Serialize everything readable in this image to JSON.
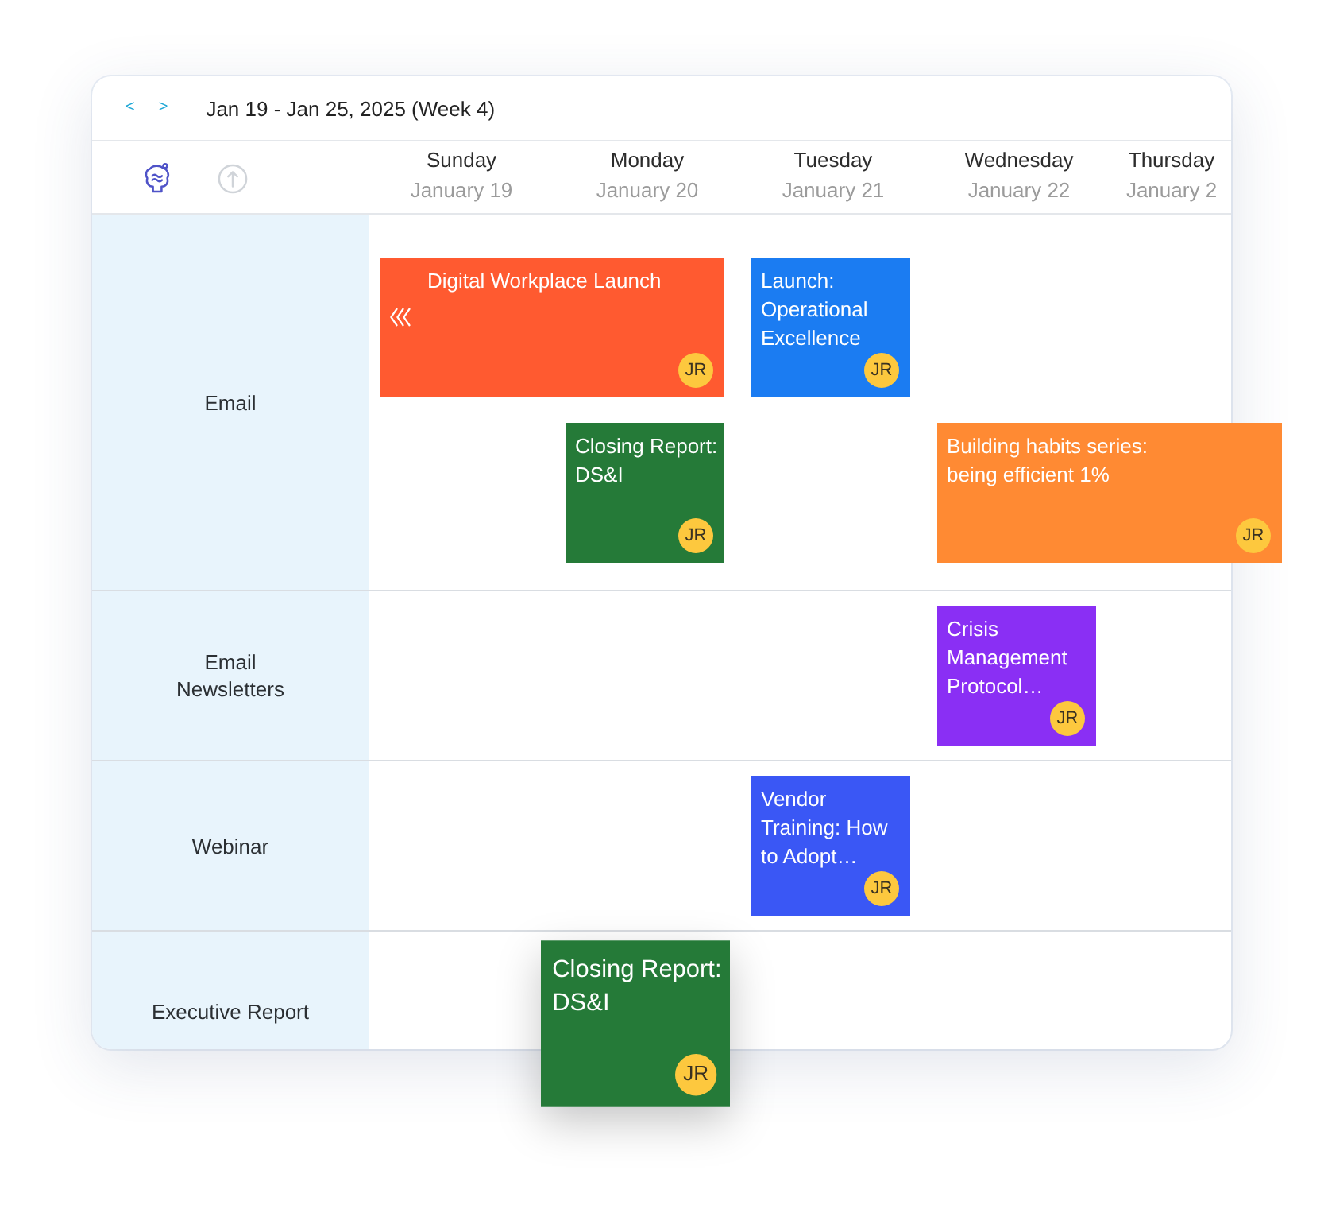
{
  "toolbar": {
    "prev": "<",
    "next": ">",
    "range": "Jan 19 - Jan 25, 2025 (Week 4)"
  },
  "days": [
    {
      "name": "Sunday",
      "date": "January 19"
    },
    {
      "name": "Monday",
      "date": "January 20"
    },
    {
      "name": "Tuesday",
      "date": "January 21"
    },
    {
      "name": "Wednesday",
      "date": "January 22"
    },
    {
      "name": "Thursday",
      "date": "January 2"
    }
  ],
  "rows": [
    {
      "label": "Email",
      "lanes": [
        [
          {
            "kind": "event",
            "title": "Digital Workplace Launch",
            "color": "#ff5a30",
            "assignee": "JR",
            "continues_before": true,
            "dragging": false
          },
          {
            "kind": "continued"
          },
          {
            "kind": "event",
            "title": "Launch: Operational Excellence",
            "color": "#1b7cf2",
            "assignee": "JR",
            "continues_before": false,
            "dragging": false
          },
          {
            "kind": "empty"
          },
          {
            "kind": "empty"
          }
        ],
        [
          {
            "kind": "empty"
          },
          {
            "kind": "event",
            "title": "Closing Report: DS&I",
            "color": "#257a38",
            "assignee": "JR",
            "continues_before": false,
            "dragging": false
          },
          {
            "kind": "empty"
          },
          {
            "kind": "event",
            "title": "Building habits series: being efficient 1%",
            "color": "#ff8a33",
            "assignee": "JR",
            "continues_before": false,
            "dragging": false
          },
          {
            "kind": "continued"
          }
        ]
      ]
    },
    {
      "label": "Email Newsletters",
      "lanes": [
        [
          {
            "kind": "empty"
          },
          {
            "kind": "empty"
          },
          {
            "kind": "empty"
          },
          {
            "kind": "event",
            "title": "Crisis Management Protocol…",
            "color": "#8a2ff4",
            "assignee": "JR",
            "continues_before": false,
            "dragging": false
          },
          {
            "kind": "empty"
          }
        ]
      ]
    },
    {
      "label": "Webinar",
      "lanes": [
        [
          {
            "kind": "empty"
          },
          {
            "kind": "empty"
          },
          {
            "kind": "event",
            "title": "Vendor Training: How to Adopt…",
            "color": "#3a57f5",
            "assignee": "JR",
            "continues_before": false,
            "dragging": false
          },
          {
            "kind": "empty"
          },
          {
            "kind": "empty"
          }
        ]
      ]
    },
    {
      "label": "Executive Report",
      "lanes": [
        [
          {
            "kind": "empty"
          },
          {
            "kind": "event",
            "title": "Closing Report: DS&I",
            "color": "#257a38",
            "assignee": "JR",
            "continues_before": false,
            "dragging": true
          },
          {
            "kind": "empty"
          },
          {
            "kind": "empty"
          },
          {
            "kind": "empty"
          }
        ]
      ]
    }
  ]
}
